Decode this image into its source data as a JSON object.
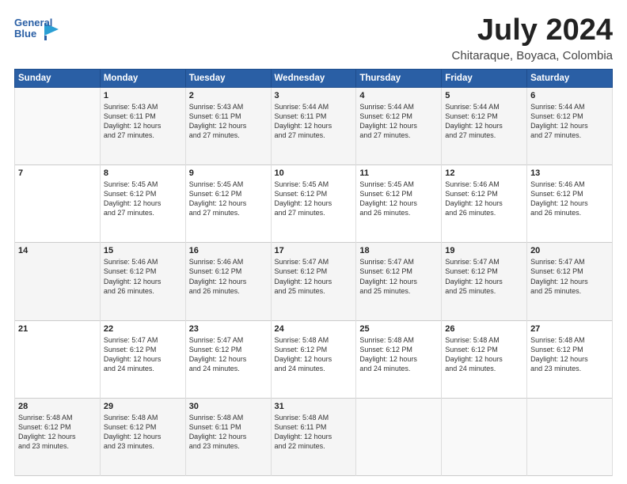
{
  "logo": {
    "line1": "General",
    "line2": "Blue"
  },
  "title": "July 2024",
  "subtitle": "Chitaraque, Boyaca, Colombia",
  "days_header": [
    "Sunday",
    "Monday",
    "Tuesday",
    "Wednesday",
    "Thursday",
    "Friday",
    "Saturday"
  ],
  "weeks": [
    [
      {
        "day": "",
        "info": ""
      },
      {
        "day": "1",
        "info": "Sunrise: 5:43 AM\nSunset: 6:11 PM\nDaylight: 12 hours\nand 27 minutes."
      },
      {
        "day": "2",
        "info": "Sunrise: 5:43 AM\nSunset: 6:11 PM\nDaylight: 12 hours\nand 27 minutes."
      },
      {
        "day": "3",
        "info": "Sunrise: 5:44 AM\nSunset: 6:11 PM\nDaylight: 12 hours\nand 27 minutes."
      },
      {
        "day": "4",
        "info": "Sunrise: 5:44 AM\nSunset: 6:12 PM\nDaylight: 12 hours\nand 27 minutes."
      },
      {
        "day": "5",
        "info": "Sunrise: 5:44 AM\nSunset: 6:12 PM\nDaylight: 12 hours\nand 27 minutes."
      },
      {
        "day": "6",
        "info": "Sunrise: 5:44 AM\nSunset: 6:12 PM\nDaylight: 12 hours\nand 27 minutes."
      }
    ],
    [
      {
        "day": "7",
        "info": ""
      },
      {
        "day": "8",
        "info": "Sunrise: 5:45 AM\nSunset: 6:12 PM\nDaylight: 12 hours\nand 27 minutes."
      },
      {
        "day": "9",
        "info": "Sunrise: 5:45 AM\nSunset: 6:12 PM\nDaylight: 12 hours\nand 27 minutes."
      },
      {
        "day": "10",
        "info": "Sunrise: 5:45 AM\nSunset: 6:12 PM\nDaylight: 12 hours\nand 27 minutes."
      },
      {
        "day": "11",
        "info": "Sunrise: 5:45 AM\nSunset: 6:12 PM\nDaylight: 12 hours\nand 26 minutes."
      },
      {
        "day": "12",
        "info": "Sunrise: 5:46 AM\nSunset: 6:12 PM\nDaylight: 12 hours\nand 26 minutes."
      },
      {
        "day": "13",
        "info": "Sunrise: 5:46 AM\nSunset: 6:12 PM\nDaylight: 12 hours\nand 26 minutes."
      }
    ],
    [
      {
        "day": "14",
        "info": ""
      },
      {
        "day": "15",
        "info": "Sunrise: 5:46 AM\nSunset: 6:12 PM\nDaylight: 12 hours\nand 26 minutes."
      },
      {
        "day": "16",
        "info": "Sunrise: 5:46 AM\nSunset: 6:12 PM\nDaylight: 12 hours\nand 26 minutes."
      },
      {
        "day": "17",
        "info": "Sunrise: 5:47 AM\nSunset: 6:12 PM\nDaylight: 12 hours\nand 25 minutes."
      },
      {
        "day": "18",
        "info": "Sunrise: 5:47 AM\nSunset: 6:12 PM\nDaylight: 12 hours\nand 25 minutes."
      },
      {
        "day": "19",
        "info": "Sunrise: 5:47 AM\nSunset: 6:12 PM\nDaylight: 12 hours\nand 25 minutes."
      },
      {
        "day": "20",
        "info": "Sunrise: 5:47 AM\nSunset: 6:12 PM\nDaylight: 12 hours\nand 25 minutes."
      }
    ],
    [
      {
        "day": "21",
        "info": ""
      },
      {
        "day": "22",
        "info": "Sunrise: 5:47 AM\nSunset: 6:12 PM\nDaylight: 12 hours\nand 24 minutes."
      },
      {
        "day": "23",
        "info": "Sunrise: 5:47 AM\nSunset: 6:12 PM\nDaylight: 12 hours\nand 24 minutes."
      },
      {
        "day": "24",
        "info": "Sunrise: 5:48 AM\nSunset: 6:12 PM\nDaylight: 12 hours\nand 24 minutes."
      },
      {
        "day": "25",
        "info": "Sunrise: 5:48 AM\nSunset: 6:12 PM\nDaylight: 12 hours\nand 24 minutes."
      },
      {
        "day": "26",
        "info": "Sunrise: 5:48 AM\nSunset: 6:12 PM\nDaylight: 12 hours\nand 24 minutes."
      },
      {
        "day": "27",
        "info": "Sunrise: 5:48 AM\nSunset: 6:12 PM\nDaylight: 12 hours\nand 23 minutes."
      }
    ],
    [
      {
        "day": "28",
        "info": "Sunrise: 5:48 AM\nSunset: 6:12 PM\nDaylight: 12 hours\nand 23 minutes."
      },
      {
        "day": "29",
        "info": "Sunrise: 5:48 AM\nSunset: 6:12 PM\nDaylight: 12 hours\nand 23 minutes."
      },
      {
        "day": "30",
        "info": "Sunrise: 5:48 AM\nSunset: 6:11 PM\nDaylight: 12 hours\nand 23 minutes."
      },
      {
        "day": "31",
        "info": "Sunrise: 5:48 AM\nSunset: 6:11 PM\nDaylight: 12 hours\nand 22 minutes."
      },
      {
        "day": "",
        "info": ""
      },
      {
        "day": "",
        "info": ""
      },
      {
        "day": "",
        "info": ""
      }
    ]
  ]
}
